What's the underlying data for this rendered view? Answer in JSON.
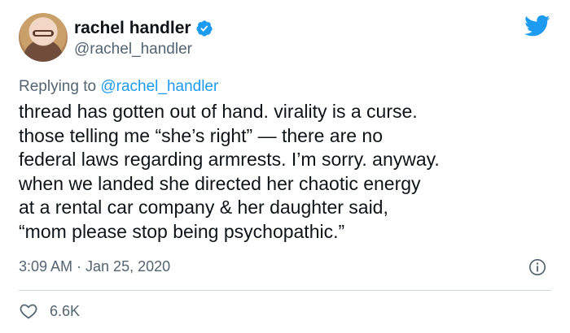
{
  "author": {
    "name": "rachel handler",
    "handle": "@rachel_handler",
    "verified_icon": "verified-badge-icon"
  },
  "brand_icon": "twitter-bird-icon",
  "reply": {
    "prefix": "Replying to ",
    "target": "@rachel_handler"
  },
  "tweet_lines": [
    "thread has gotten out of hand. virality is a curse.",
    "those telling me “she’s right” — there are no",
    "federal laws regarding armrests. I’m sorry. anyway.",
    "when we landed she directed her chaotic energy",
    "at a rental car company & her daughter said,",
    "“mom please stop being psychopathic.”"
  ],
  "timestamp": "3:09 AM · Jan 25, 2020",
  "likes": "6.6K",
  "colors": {
    "accent": "#1d9bf0",
    "text": "#0f1419",
    "muted": "#536471",
    "divider": "#cfd9de"
  }
}
